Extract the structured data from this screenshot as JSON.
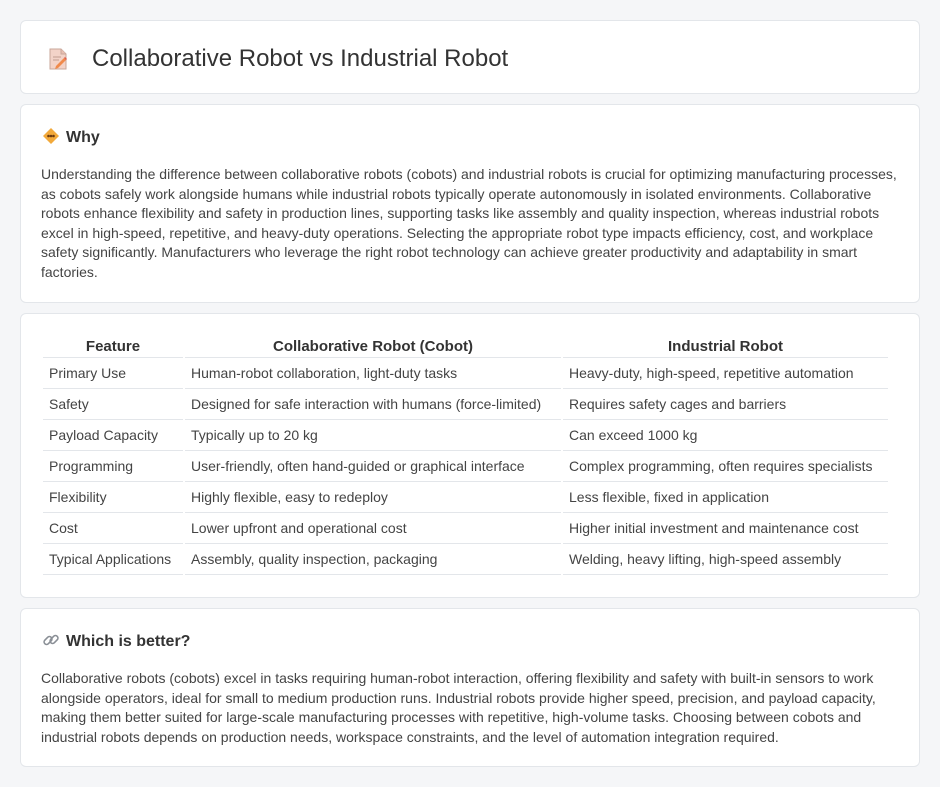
{
  "header": {
    "title": "Collaborative Robot vs Industrial Robot",
    "icon": "document-pencil-icon"
  },
  "why": {
    "heading": "Why",
    "icon": "warning-diamond-icon",
    "text": "Understanding the difference between collaborative robots (cobots) and industrial robots is crucial for optimizing manufacturing processes, as cobots safely work alongside humans while industrial robots typically operate autonomously in isolated environments. Collaborative robots enhance flexibility and safety in production lines, supporting tasks like assembly and quality inspection, whereas industrial robots excel in high-speed, repetitive, and heavy-duty operations. Selecting the appropriate robot type impacts efficiency, cost, and workplace safety significantly. Manufacturers who leverage the right robot technology can achieve greater productivity and adaptability in smart factories."
  },
  "table": {
    "headers": [
      "Feature",
      "Collaborative Robot (Cobot)",
      "Industrial Robot"
    ],
    "rows": [
      [
        "Primary Use",
        "Human-robot collaboration, light-duty tasks",
        "Heavy-duty, high-speed, repetitive automation"
      ],
      [
        "Safety",
        "Designed for safe interaction with humans (force-limited)",
        "Requires safety cages and barriers"
      ],
      [
        "Payload Capacity",
        "Typically up to 20 kg",
        "Can exceed 1000 kg"
      ],
      [
        "Programming",
        "User-friendly, often hand-guided or graphical interface",
        "Complex programming, often requires specialists"
      ],
      [
        "Flexibility",
        "Highly flexible, easy to redeploy",
        "Less flexible, fixed in application"
      ],
      [
        "Cost",
        "Lower upfront and operational cost",
        "Higher initial investment and maintenance cost"
      ],
      [
        "Typical Applications",
        "Assembly, quality inspection, packaging",
        "Welding, heavy lifting, high-speed assembly"
      ]
    ]
  },
  "better": {
    "heading": "Which is better?",
    "icon": "link-icon",
    "text": "Collaborative robots (cobots) excel in tasks requiring human-robot interaction, offering flexibility and safety with built-in sensors to work alongside operators, ideal for small to medium production runs. Industrial robots provide higher speed, precision, and payload capacity, making them better suited for large-scale manufacturing processes with repetitive, high-volume tasks. Choosing between cobots and industrial robots depends on production needs, workspace constraints, and the level of automation integration required."
  }
}
